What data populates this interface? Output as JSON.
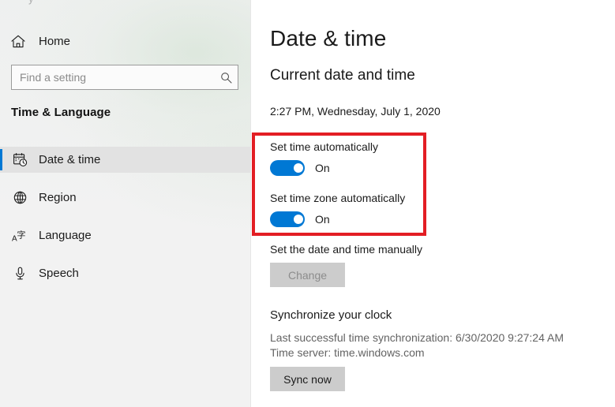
{
  "window": {
    "title": "Date & time"
  },
  "sidebar": {
    "top_partial_text": "y",
    "home": {
      "label": "Home",
      "icon": "home-icon"
    },
    "search": {
      "placeholder": "Find a setting",
      "value": "",
      "icon": "search-icon"
    },
    "category_title": "Time & Language",
    "items": [
      {
        "label": "Date & time",
        "icon": "calendar-clock-icon",
        "selected": true
      },
      {
        "label": "Region",
        "icon": "globe-icon",
        "selected": false
      },
      {
        "label": "Language",
        "icon": "language-icon",
        "selected": false
      },
      {
        "label": "Speech",
        "icon": "microphone-icon",
        "selected": false
      }
    ]
  },
  "main": {
    "page_title": "Date & time",
    "sections": {
      "current": {
        "heading": "Current date and time",
        "value": "2:27 PM, Wednesday, July 1, 2020"
      },
      "auto": {
        "set_time_label": "Set time automatically",
        "set_time_state": "On",
        "set_timezone_label": "Set time zone automatically",
        "set_timezone_state": "On"
      },
      "manual": {
        "label": "Set the date and time manually",
        "button_label": "Change",
        "button_disabled": true
      },
      "sync": {
        "heading": "Synchronize your clock",
        "last_sync": "Last successful time synchronization: 6/30/2020 9:27:24 AM",
        "time_server": "Time server: time.windows.com",
        "button_label": "Sync now",
        "button_disabled": false
      }
    }
  },
  "annotation": {
    "highlight_color": "#e31e24",
    "highlight_shape": "rectangle"
  },
  "colors": {
    "accent": "#0078d4",
    "sidebar_bg": "#f2f2f2",
    "content_bg": "#ffffff",
    "button_bg": "#cccccc",
    "disabled_text": "#8c8c8c",
    "secondary_text": "#636363"
  }
}
